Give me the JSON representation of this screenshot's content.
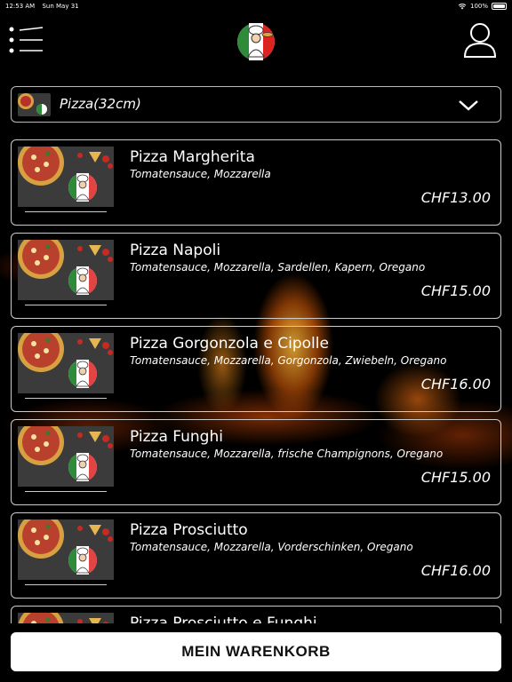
{
  "status": {
    "time": "12:53 AM",
    "date": "Sun May 31",
    "battery": "100%"
  },
  "header": {
    "menu_icon": "menu-list-icon",
    "logo_icon": "chef-logo-icon",
    "user_icon": "user-account-icon"
  },
  "category": {
    "label": "Pizza(32cm)",
    "icon": "chevron-down-icon"
  },
  "products": [
    {
      "name": "Pizza Margherita",
      "desc": "Tomatensauce, Mozzarella",
      "price": "CHF13.00"
    },
    {
      "name": "Pizza Napoli",
      "desc": "Tomatensauce, Mozzarella, Sardellen, Kapern, Oregano",
      "price": "CHF15.00"
    },
    {
      "name": "Pizza Gorgonzola e Cipolle",
      "desc": "Tomatensauce, Mozzarella, Gorgonzola, Zwiebeln, Oregano",
      "price": "CHF16.00"
    },
    {
      "name": "Pizza Funghi",
      "desc": "Tomatensauce, Mozzarella, frische Champignons, Oregano",
      "price": "CHF15.00"
    },
    {
      "name": "Pizza Prosciutto",
      "desc": "Tomatensauce, Mozzarella, Vorderschinken, Oregano",
      "price": "CHF16.00"
    },
    {
      "name": "Pizza Prosciutto e Funghi",
      "desc": "",
      "price": ""
    }
  ],
  "cart": {
    "label": "MEIN WARENKORB"
  },
  "colors": {
    "background": "#000000",
    "border": "#cccccc",
    "button_bg": "#ffffff",
    "button_text": "#111111"
  }
}
